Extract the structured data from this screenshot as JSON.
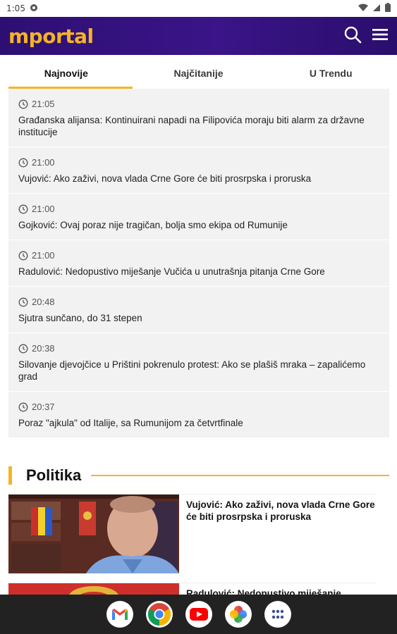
{
  "status_bar": {
    "time": "1:05"
  },
  "header": {
    "logo": "mportal"
  },
  "tabs": [
    {
      "label": "Najnovije",
      "active": true
    },
    {
      "label": "Najčitanije",
      "active": false
    },
    {
      "label": "U Trendu",
      "active": false
    }
  ],
  "feed": [
    {
      "time": "21:05",
      "title": "Građanska alijansa: Kontinuirani napadi na Filipovića moraju biti alarm za državne institucije"
    },
    {
      "time": "21:00",
      "title": "Vujović: Ako zaživi, nova vlada Crne Gore će biti prosrpska i proruska"
    },
    {
      "time": "21:00",
      "title": "Gojković: Ovaj poraz nije tragičan, bolja smo ekipa od Rumunije"
    },
    {
      "time": "21:00",
      "title": "Radulović: Nedopustivo miješanje Vučića u unutrašnja pitanja Crne Gore"
    },
    {
      "time": "20:48",
      "title": "Sjutra sunčano, do 31 stepen"
    },
    {
      "time": "20:38",
      "title": "Silovanje djevojčice u Prištini pokrenulo protest: Ako se plašiš mraka – zapalićemo grad"
    },
    {
      "time": "20:37",
      "title": "Poraz \"ajkula\" od Italije, sa Rumunijom za četvrtfinale"
    }
  ],
  "section": {
    "title": "Politika"
  },
  "articles": [
    {
      "headline": "Vujović: Ako zaživi, nova vlada Crne Gore će biti prosrpska i proruska"
    },
    {
      "headline": "Radulović: Nedopustivo miješanje"
    }
  ],
  "dock": [
    "gmail-icon",
    "chrome-icon",
    "youtube-icon",
    "photos-icon",
    "app-drawer-icon"
  ],
  "colors": {
    "brand_purple": "#2d0f73",
    "accent_yellow": "#f5b423"
  }
}
